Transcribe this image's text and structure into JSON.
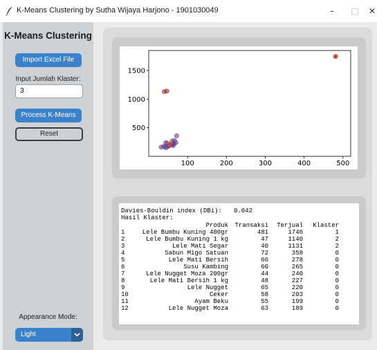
{
  "window": {
    "title": "K-Means Clustering by Sutha Wijaya Harjono - 1901030049",
    "controls": {
      "minimize": "–",
      "maximize": "□",
      "close": "✕"
    }
  },
  "sidebar": {
    "title": "K-Means Clustering",
    "import_label": "Import Excel File",
    "k_label": "Input Jumlah Klaster:",
    "k_value": "3",
    "process_label": "Process K-Means",
    "reset_label": "Reset",
    "appearance_label": "Appearance Mode:",
    "appearance_value": "Light"
  },
  "chart_data": {
    "type": "scatter",
    "title": "",
    "xlabel": "",
    "ylabel": "",
    "xlim": [
      0,
      520
    ],
    "ylim": [
      0,
      1850
    ],
    "xticks": [
      100,
      200,
      300,
      400,
      500
    ],
    "yticks": [
      500,
      1000,
      1500
    ],
    "grid": false,
    "point_color": "#6b3d8f",
    "centroid_color": "#d62728",
    "points": [
      [
        481,
        1746
      ],
      [
        47,
        1140
      ],
      [
        40,
        1131
      ],
      [
        72,
        358
      ],
      [
        66,
        278
      ],
      [
        60,
        265
      ],
      [
        44,
        240
      ],
      [
        48,
        227
      ],
      [
        65,
        220
      ],
      [
        58,
        203
      ],
      [
        55,
        199
      ],
      [
        63,
        189
      ],
      [
        32,
        160
      ],
      [
        50,
        175
      ],
      [
        42,
        168
      ],
      [
        38,
        172
      ],
      [
        52,
        185
      ],
      [
        45,
        150
      ],
      [
        70,
        240
      ],
      [
        62,
        210
      ]
    ],
    "centroids": [
      [
        481,
        1746
      ],
      [
        43.5,
        1135.5
      ],
      [
        54,
        215
      ]
    ]
  },
  "results": {
    "dbi_label": "Davies-Bouldin index (DBi):",
    "dbi_value": "0.042",
    "heading": "Hasil Klaster:",
    "columns": [
      "Produk",
      "Transaksi",
      "Terjual",
      "Klaster"
    ],
    "rows": [
      [
        "1",
        "Lele Bumbu Kuning 400gr",
        "481",
        "1746",
        "1"
      ],
      [
        "2",
        "Lele Bumbu Kuning 1 kg",
        "47",
        "1140",
        "2"
      ],
      [
        "3",
        "Lele Mati Segar",
        "40",
        "1131",
        "2"
      ],
      [
        "4",
        "Sabun Migo Satuan",
        "72",
        "358",
        "0"
      ],
      [
        "5",
        "Lele Mati Bersih",
        "66",
        "278",
        "0"
      ],
      [
        "6",
        "Susu Kambing",
        "60",
        "265",
        "0"
      ],
      [
        "7",
        "Lele Nugget Moza 200gr",
        "44",
        "240",
        "0"
      ],
      [
        "8",
        "Lele Mati Bersih 1 kg",
        "48",
        "227",
        "0"
      ],
      [
        "9",
        "Lele Nugget",
        "65",
        "220",
        "0"
      ],
      [
        "10",
        "Ceker",
        "58",
        "203",
        "0"
      ],
      [
        "11",
        "Ayam Beku",
        "55",
        "199",
        "0"
      ],
      [
        "12",
        "Lele Nugget Moza",
        "63",
        "189",
        "0"
      ]
    ]
  }
}
